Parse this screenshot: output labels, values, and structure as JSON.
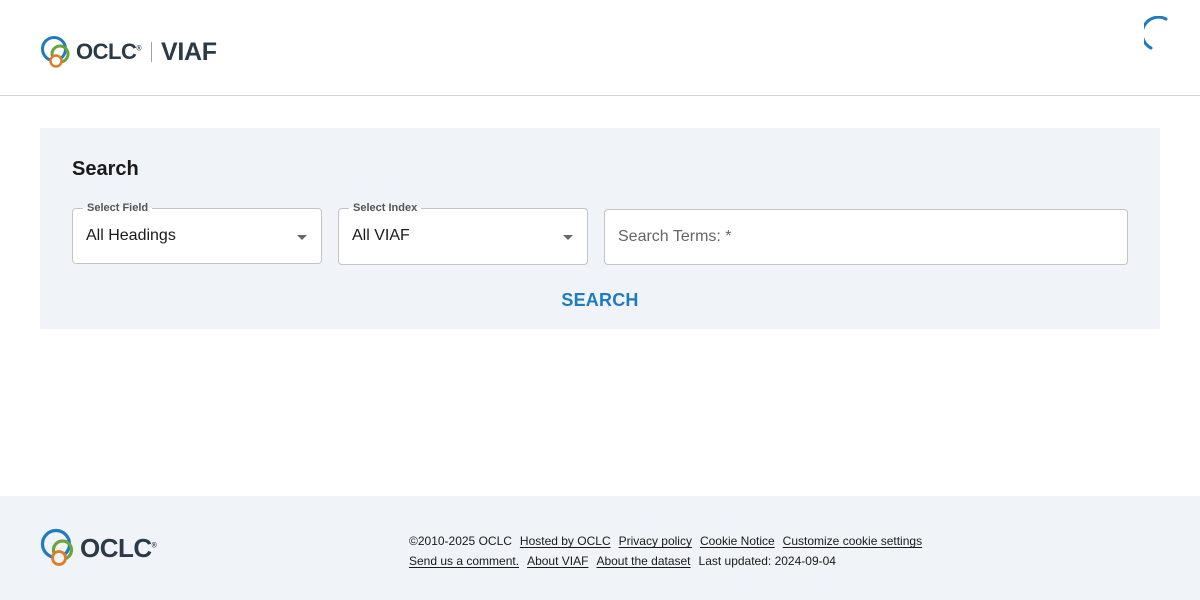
{
  "header": {
    "brand_name": "OCLC",
    "brand_reg": "®",
    "product_name": "VIAF",
    "spinner_icon": "loading-spinner-icon"
  },
  "search_panel": {
    "title": "Search",
    "select_field": {
      "label": "Select Field",
      "value": "All Headings"
    },
    "select_index": {
      "label": "Select Index",
      "value": "All VIAF"
    },
    "search_terms": {
      "placeholder": "Search Terms: *",
      "value": ""
    },
    "search_button": "SEARCH"
  },
  "footer": {
    "brand_name": "OCLC",
    "brand_reg": "®",
    "copyright": "©2010-2025 OCLC",
    "links_row1": [
      "Hosted by OCLC",
      "Privacy policy",
      "Cookie Notice",
      "Customize cookie settings"
    ],
    "links_row2": [
      "Send us a comment.",
      "About VIAF",
      "About the dataset"
    ],
    "last_updated": "Last updated: 2024-09-04"
  },
  "colors": {
    "accent": "#1f7bc1",
    "brand_text": "#2b3a47",
    "panel_bg": "#f0f3f8",
    "logo_blue": "#1f7bc1",
    "logo_green": "#6ba539",
    "logo_orange": "#e07b28"
  }
}
